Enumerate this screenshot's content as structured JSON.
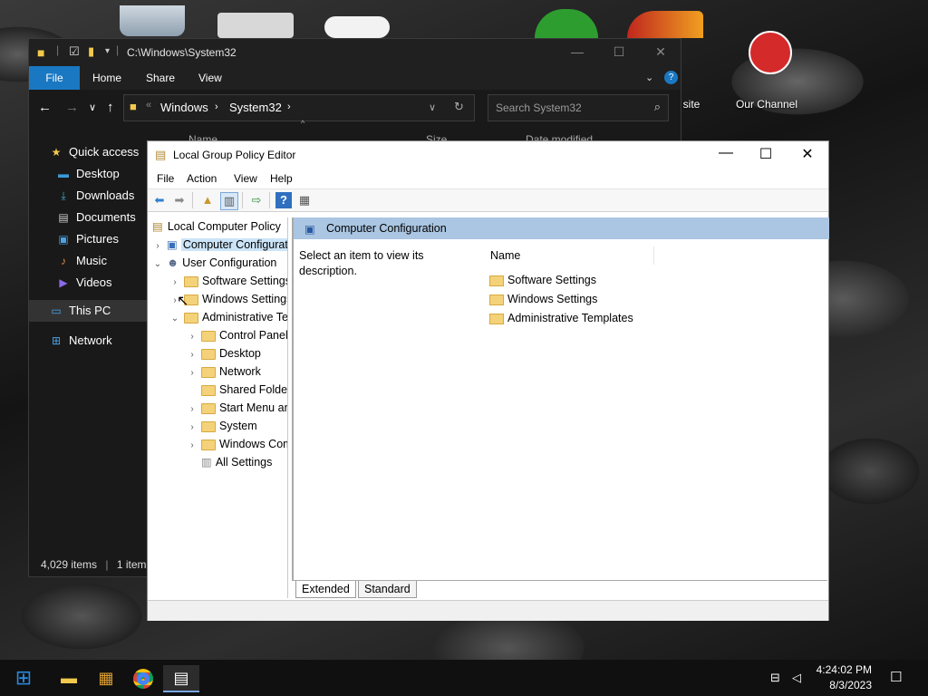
{
  "desktop": {
    "icons": [
      {
        "label": "site"
      },
      {
        "label": "Our Channel"
      }
    ]
  },
  "explorer": {
    "title_path": "C:\\Windows\\System32",
    "ribbon_tabs": [
      "File",
      "Home",
      "Share",
      "View"
    ],
    "address": {
      "root_glyph": "«",
      "crumb1": "Windows",
      "crumb2": "System32"
    },
    "search_placeholder": "Search System32",
    "columns": {
      "name": "Name",
      "size": "Size",
      "date_modified": "Date modified"
    },
    "nav_items": [
      {
        "label": "Quick access",
        "icon": "star-icon"
      },
      {
        "label": "Desktop",
        "icon": "desktop-folder-icon"
      },
      {
        "label": "Downloads",
        "icon": "downloads-icon"
      },
      {
        "label": "Documents",
        "icon": "documents-icon"
      },
      {
        "label": "Pictures",
        "icon": "pictures-icon"
      },
      {
        "label": "Music",
        "icon": "music-icon"
      },
      {
        "label": "Videos",
        "icon": "videos-icon"
      },
      {
        "label": "This PC",
        "icon": "computer-icon"
      },
      {
        "label": "Network",
        "icon": "network-icon"
      }
    ],
    "status": {
      "items": "4,029 items",
      "selected": "1 item"
    }
  },
  "gpe": {
    "title": "Local Group Policy Editor",
    "menu": [
      "File",
      "Action",
      "View",
      "Help"
    ],
    "tree": [
      {
        "label": "Local Computer Policy"
      },
      {
        "label": "Computer Configuration"
      },
      {
        "label": "User Configuration"
      },
      {
        "label": "Software Settings"
      },
      {
        "label": "Windows Settings"
      },
      {
        "label": "Administrative Templates"
      },
      {
        "label": "Control Panel"
      },
      {
        "label": "Desktop"
      },
      {
        "label": "Network"
      },
      {
        "label": "Shared Folders"
      },
      {
        "label": "Start Menu and Taskbar"
      },
      {
        "label": "System"
      },
      {
        "label": "Windows Components"
      },
      {
        "label": "All Settings"
      }
    ],
    "right_header": "Computer Configuration",
    "description": "Select an item to view its description.",
    "name_column": "Name",
    "items": [
      "Software Settings",
      "Windows Settings",
      "Administrative Templates"
    ],
    "tabs": [
      "Extended",
      "Standard"
    ]
  },
  "taskbar": {
    "time": "4:24:02 PM",
    "date": "8/3/2023"
  },
  "colors": {
    "explorer_bg": "#191919",
    "accent": "#1a78c2",
    "selection": "#cce4f7",
    "banner": "#aac6e2"
  }
}
